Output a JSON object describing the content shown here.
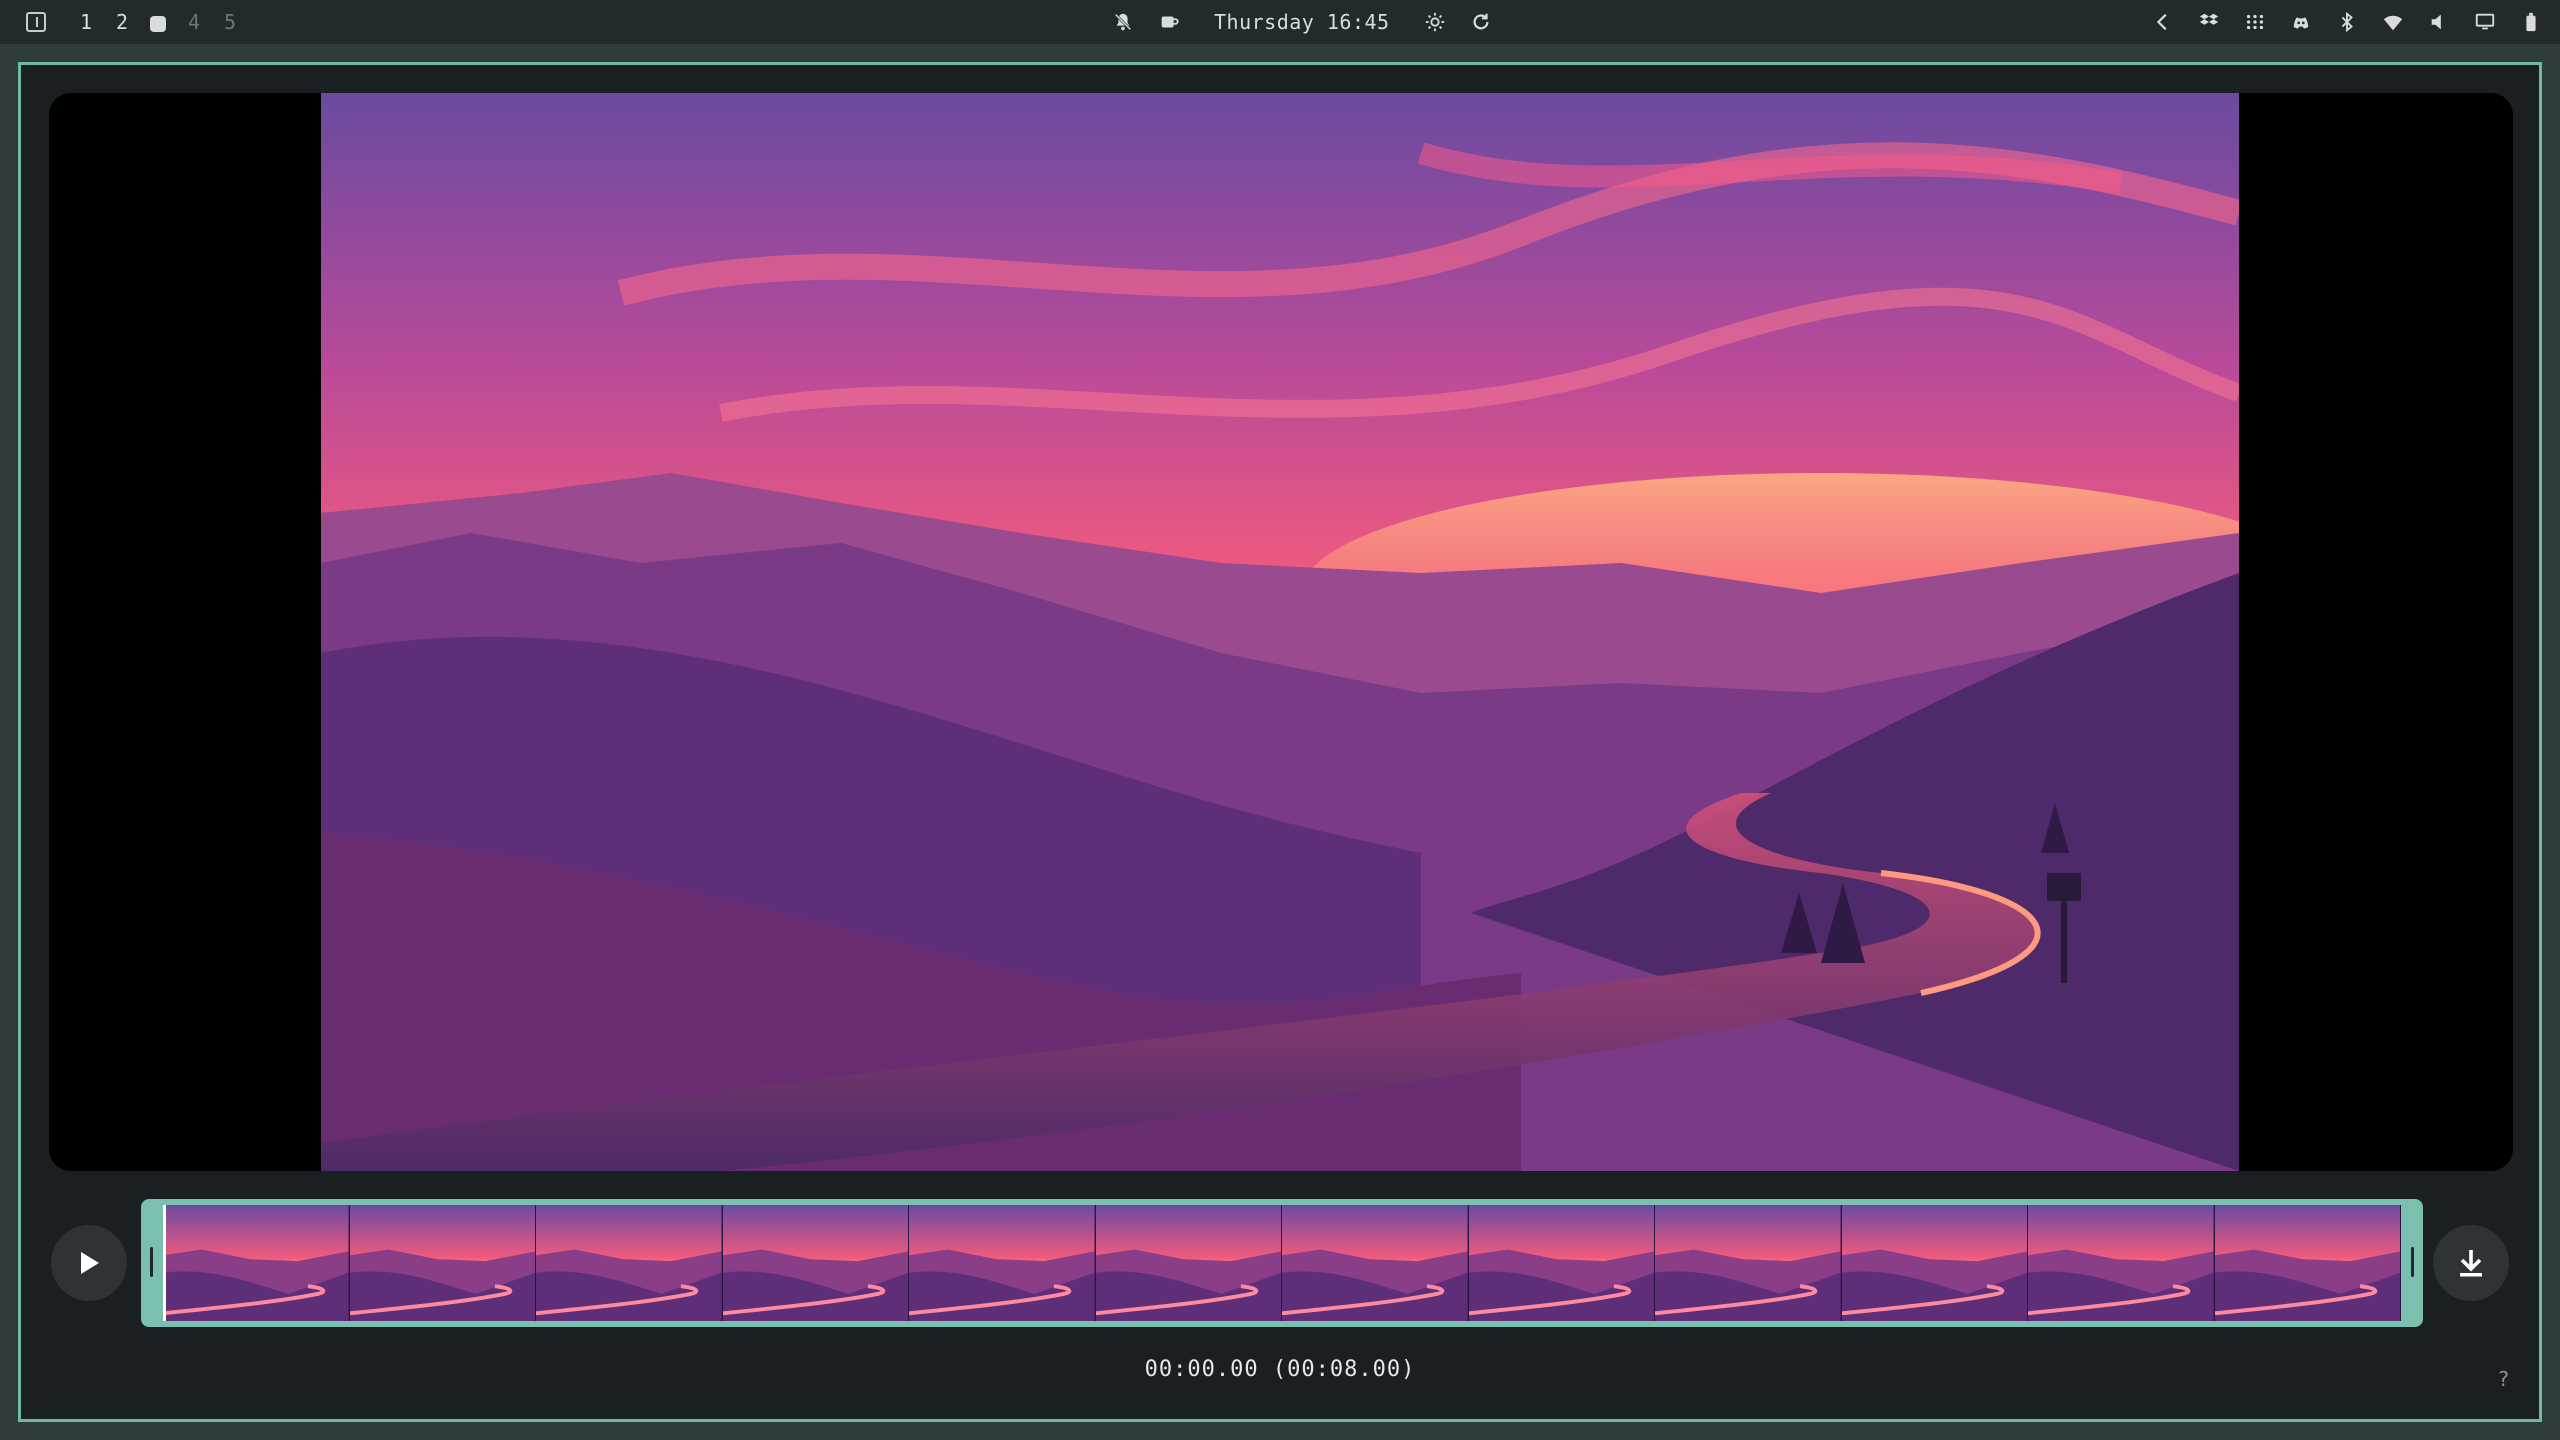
{
  "topbar": {
    "workspaces": [
      {
        "label": "1",
        "state": "normal"
      },
      {
        "label": "2",
        "state": "normal"
      },
      {
        "label": "",
        "state": "active"
      },
      {
        "label": "4",
        "state": "dim"
      },
      {
        "label": "5",
        "state": "dim"
      }
    ],
    "clock": "Thursday 16:45",
    "center_icons": [
      "notifications-off-icon",
      "caffeine-icon",
      "brightness-icon",
      "refresh-icon"
    ],
    "tray_icons": [
      "chevron-left-icon",
      "dropbox-icon",
      "apps-grid-icon",
      "discord-icon",
      "bluetooth-icon",
      "wifi-icon",
      "volume-icon",
      "display-icon",
      "battery-icon"
    ]
  },
  "player": {
    "timecode": "00:00.00 (00:08.00)",
    "help": "?",
    "thumbnail_count": 12,
    "accent": "#7bbfb1"
  }
}
